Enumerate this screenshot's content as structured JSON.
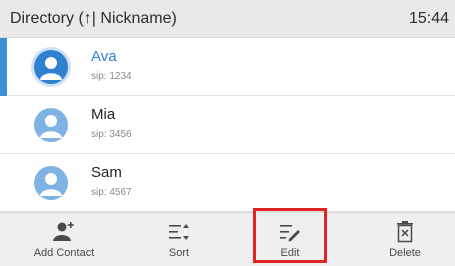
{
  "header": {
    "title": "Directory (↑| Nickname)",
    "time": "15:44"
  },
  "contacts": [
    {
      "name": "Ava",
      "number": "sip: 1234",
      "selected": true
    },
    {
      "name": "Mia",
      "number": "sip: 3456",
      "selected": false
    },
    {
      "name": "Sam",
      "number": "sip: 4567",
      "selected": false
    }
  ],
  "toolbar": {
    "add_contact": "Add Contact",
    "sort": "Sort",
    "edit": "Edit",
    "delete": "Delete"
  },
  "colors": {
    "accent": "#2f80cf",
    "highlight": "#e02424",
    "header_bg": "#e9e9e9",
    "toolbar_bg": "#efefef"
  },
  "icons": [
    "person-icon",
    "add-contact-icon",
    "sort-icon",
    "edit-icon",
    "delete-icon"
  ]
}
